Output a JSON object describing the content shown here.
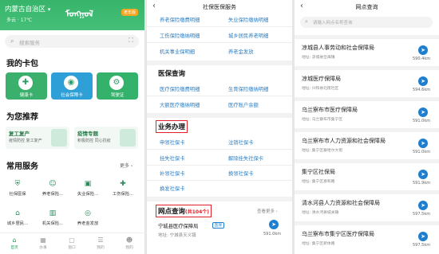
{
  "panel1": {
    "region": "内蒙古自治区",
    "weather": "多云 · 17℃",
    "mongol_title": "ᠮᠣᠩᠭᠣᠯ",
    "elderly_badge": "老年版",
    "search_placeholder": "搜索服务",
    "my_cards_title": "我的卡包",
    "cards": [
      {
        "label": "健康卡",
        "color": "#3bb06c",
        "icon": "✚"
      },
      {
        "label": "社会保障卡",
        "color": "#2f9fd8",
        "icon": "◉"
      },
      {
        "label": "驾驶证",
        "color": "#34b26b",
        "icon": "⚙"
      }
    ],
    "recommend_title": "为您推荐",
    "recommend": [
      {
        "title": "复工复产",
        "subtitle": "疫情防控 复工复产"
      },
      {
        "title": "疫情专题",
        "subtitle": "积极防控 同心抗疫"
      }
    ],
    "common_title": "常用服务",
    "more": "更多 ›",
    "services_row1": [
      "社保医保",
      "养老保险...",
      "失业保险...",
      "工伤保险..."
    ],
    "services_row2": [
      "城乡居民...",
      "机关保险...",
      "养老金发放",
      ""
    ],
    "tabs": [
      "首页",
      "办事",
      "窗口",
      "我的",
      "我的"
    ]
  },
  "panel2": {
    "title": "社保医保服务",
    "links_top": [
      [
        "养老保险缴费明细",
        "失业保险缴纳明细"
      ],
      [
        "工伤保险缴纳明细",
        "城乡居民养老明细"
      ],
      [
        "机关事业保明细",
        "养老金发放"
      ]
    ],
    "medical_title": "医保查询",
    "medical_links": [
      [
        "医疗保险缴费明细",
        "生育保险缴纳明细"
      ],
      [
        "大额医疗缴纳明细",
        "医疗账户余额"
      ]
    ],
    "business_title": "业务办理",
    "business_links": [
      [
        "申领社保卡",
        "注销社保卡"
      ],
      [
        "挂失社保卡",
        "解除挂失社保卡"
      ],
      [
        "补领社保卡",
        "换领社保卡"
      ],
      [
        "换发社保卡",
        ""
      ]
    ],
    "outlet_title": "网点查询",
    "outlet_count": "(共104个)",
    "view_all": "查看更多 ›",
    "outlet_name": "宁城县医疗保障局",
    "outlet_tag": "医保",
    "outlet_addr": "地址: 宁城县天义镇",
    "outlet_dist": "591.0km"
  },
  "panel3": {
    "title": "网点查询",
    "search_placeholder": "请输入网点名称查询",
    "entries": [
      {
        "name": "凉城县人事劳动和社会保障局",
        "addr": "地址: 凉城县岱海镇",
        "dist": "590.4km"
      },
      {
        "name": "凉城医疗保障局",
        "addr": "地址: 兴和县北街社区",
        "dist": "594.6km"
      },
      {
        "name": "乌兰察布市医疗保障局",
        "addr": "地址: 乌兰察布市集宁区",
        "dist": "591.0km"
      },
      {
        "name": "乌兰察布市人力资源和社会保障局",
        "addr": "地址: 集宁区察哈尔大街",
        "dist": "591.0km"
      },
      {
        "name": "集宁区社保局",
        "addr": "地址: 集宁区恩和路",
        "dist": "591.9km"
      },
      {
        "name": "清水河县人力资源和社会保障局",
        "addr": "地址: 清水河县城关镇",
        "dist": "597.5km"
      },
      {
        "name": "乌兰察布市集宁区医疗保障局",
        "addr": "地址: 集宁区新体路",
        "dist": "597.5km"
      }
    ]
  }
}
